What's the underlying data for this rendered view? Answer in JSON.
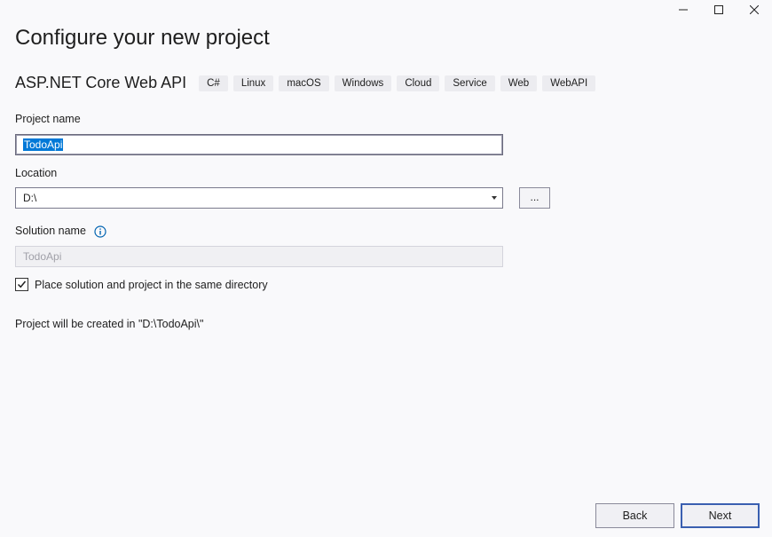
{
  "window": {
    "controls": [
      "minimize-icon",
      "maximize-icon",
      "close-icon"
    ]
  },
  "header": {
    "title": "Configure your new project"
  },
  "template": {
    "name": "ASP.NET Core Web API",
    "tags": [
      "C#",
      "Linux",
      "macOS",
      "Windows",
      "Cloud",
      "Service",
      "Web",
      "WebAPI"
    ]
  },
  "form": {
    "project_name_label": "Project name",
    "project_name_value": "TodoApi",
    "location_label": "Location",
    "location_value": "D:\\",
    "browse_label": "...",
    "solution_name_label": "Solution name",
    "solution_name_value": "TodoApi",
    "same_directory_label": "Place solution and project in the same directory",
    "same_directory_checked": true,
    "created_path_text": "Project will be created in \"D:\\TodoApi\\\""
  },
  "footer": {
    "back_label": "Back",
    "next_label": "Next"
  },
  "colors": {
    "selection": "#0078d7",
    "info_icon": "#0063b1",
    "tag_background": "#ececf0",
    "primary_border": "#3a5fb0"
  }
}
